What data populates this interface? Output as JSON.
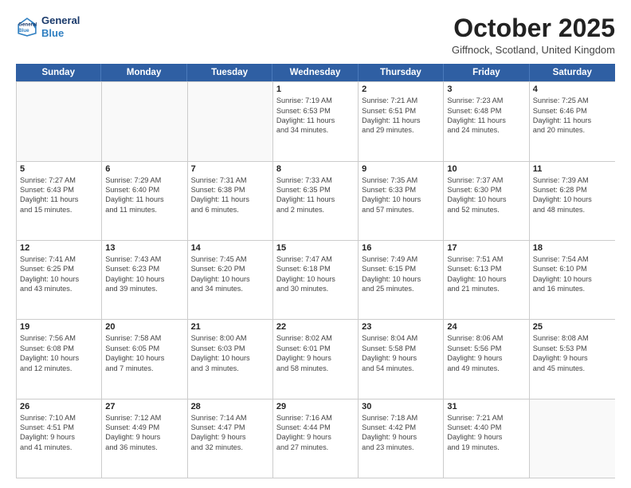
{
  "header": {
    "logo_line1": "General",
    "logo_line2": "Blue",
    "month": "October 2025",
    "location": "Giffnock, Scotland, United Kingdom"
  },
  "days_of_week": [
    "Sunday",
    "Monday",
    "Tuesday",
    "Wednesday",
    "Thursday",
    "Friday",
    "Saturday"
  ],
  "weeks": [
    [
      {
        "day": "",
        "lines": []
      },
      {
        "day": "",
        "lines": []
      },
      {
        "day": "",
        "lines": []
      },
      {
        "day": "1",
        "lines": [
          "Sunrise: 7:19 AM",
          "Sunset: 6:53 PM",
          "Daylight: 11 hours",
          "and 34 minutes."
        ]
      },
      {
        "day": "2",
        "lines": [
          "Sunrise: 7:21 AM",
          "Sunset: 6:51 PM",
          "Daylight: 11 hours",
          "and 29 minutes."
        ]
      },
      {
        "day": "3",
        "lines": [
          "Sunrise: 7:23 AM",
          "Sunset: 6:48 PM",
          "Daylight: 11 hours",
          "and 24 minutes."
        ]
      },
      {
        "day": "4",
        "lines": [
          "Sunrise: 7:25 AM",
          "Sunset: 6:46 PM",
          "Daylight: 11 hours",
          "and 20 minutes."
        ]
      }
    ],
    [
      {
        "day": "5",
        "lines": [
          "Sunrise: 7:27 AM",
          "Sunset: 6:43 PM",
          "Daylight: 11 hours",
          "and 15 minutes."
        ]
      },
      {
        "day": "6",
        "lines": [
          "Sunrise: 7:29 AM",
          "Sunset: 6:40 PM",
          "Daylight: 11 hours",
          "and 11 minutes."
        ]
      },
      {
        "day": "7",
        "lines": [
          "Sunrise: 7:31 AM",
          "Sunset: 6:38 PM",
          "Daylight: 11 hours",
          "and 6 minutes."
        ]
      },
      {
        "day": "8",
        "lines": [
          "Sunrise: 7:33 AM",
          "Sunset: 6:35 PM",
          "Daylight: 11 hours",
          "and 2 minutes."
        ]
      },
      {
        "day": "9",
        "lines": [
          "Sunrise: 7:35 AM",
          "Sunset: 6:33 PM",
          "Daylight: 10 hours",
          "and 57 minutes."
        ]
      },
      {
        "day": "10",
        "lines": [
          "Sunrise: 7:37 AM",
          "Sunset: 6:30 PM",
          "Daylight: 10 hours",
          "and 52 minutes."
        ]
      },
      {
        "day": "11",
        "lines": [
          "Sunrise: 7:39 AM",
          "Sunset: 6:28 PM",
          "Daylight: 10 hours",
          "and 48 minutes."
        ]
      }
    ],
    [
      {
        "day": "12",
        "lines": [
          "Sunrise: 7:41 AM",
          "Sunset: 6:25 PM",
          "Daylight: 10 hours",
          "and 43 minutes."
        ]
      },
      {
        "day": "13",
        "lines": [
          "Sunrise: 7:43 AM",
          "Sunset: 6:23 PM",
          "Daylight: 10 hours",
          "and 39 minutes."
        ]
      },
      {
        "day": "14",
        "lines": [
          "Sunrise: 7:45 AM",
          "Sunset: 6:20 PM",
          "Daylight: 10 hours",
          "and 34 minutes."
        ]
      },
      {
        "day": "15",
        "lines": [
          "Sunrise: 7:47 AM",
          "Sunset: 6:18 PM",
          "Daylight: 10 hours",
          "and 30 minutes."
        ]
      },
      {
        "day": "16",
        "lines": [
          "Sunrise: 7:49 AM",
          "Sunset: 6:15 PM",
          "Daylight: 10 hours",
          "and 25 minutes."
        ]
      },
      {
        "day": "17",
        "lines": [
          "Sunrise: 7:51 AM",
          "Sunset: 6:13 PM",
          "Daylight: 10 hours",
          "and 21 minutes."
        ]
      },
      {
        "day": "18",
        "lines": [
          "Sunrise: 7:54 AM",
          "Sunset: 6:10 PM",
          "Daylight: 10 hours",
          "and 16 minutes."
        ]
      }
    ],
    [
      {
        "day": "19",
        "lines": [
          "Sunrise: 7:56 AM",
          "Sunset: 6:08 PM",
          "Daylight: 10 hours",
          "and 12 minutes."
        ]
      },
      {
        "day": "20",
        "lines": [
          "Sunrise: 7:58 AM",
          "Sunset: 6:05 PM",
          "Daylight: 10 hours",
          "and 7 minutes."
        ]
      },
      {
        "day": "21",
        "lines": [
          "Sunrise: 8:00 AM",
          "Sunset: 6:03 PM",
          "Daylight: 10 hours",
          "and 3 minutes."
        ]
      },
      {
        "day": "22",
        "lines": [
          "Sunrise: 8:02 AM",
          "Sunset: 6:01 PM",
          "Daylight: 9 hours",
          "and 58 minutes."
        ]
      },
      {
        "day": "23",
        "lines": [
          "Sunrise: 8:04 AM",
          "Sunset: 5:58 PM",
          "Daylight: 9 hours",
          "and 54 minutes."
        ]
      },
      {
        "day": "24",
        "lines": [
          "Sunrise: 8:06 AM",
          "Sunset: 5:56 PM",
          "Daylight: 9 hours",
          "and 49 minutes."
        ]
      },
      {
        "day": "25",
        "lines": [
          "Sunrise: 8:08 AM",
          "Sunset: 5:53 PM",
          "Daylight: 9 hours",
          "and 45 minutes."
        ]
      }
    ],
    [
      {
        "day": "26",
        "lines": [
          "Sunrise: 7:10 AM",
          "Sunset: 4:51 PM",
          "Daylight: 9 hours",
          "and 41 minutes."
        ]
      },
      {
        "day": "27",
        "lines": [
          "Sunrise: 7:12 AM",
          "Sunset: 4:49 PM",
          "Daylight: 9 hours",
          "and 36 minutes."
        ]
      },
      {
        "day": "28",
        "lines": [
          "Sunrise: 7:14 AM",
          "Sunset: 4:47 PM",
          "Daylight: 9 hours",
          "and 32 minutes."
        ]
      },
      {
        "day": "29",
        "lines": [
          "Sunrise: 7:16 AM",
          "Sunset: 4:44 PM",
          "Daylight: 9 hours",
          "and 27 minutes."
        ]
      },
      {
        "day": "30",
        "lines": [
          "Sunrise: 7:18 AM",
          "Sunset: 4:42 PM",
          "Daylight: 9 hours",
          "and 23 minutes."
        ]
      },
      {
        "day": "31",
        "lines": [
          "Sunrise: 7:21 AM",
          "Sunset: 4:40 PM",
          "Daylight: 9 hours",
          "and 19 minutes."
        ]
      },
      {
        "day": "",
        "lines": []
      }
    ]
  ]
}
